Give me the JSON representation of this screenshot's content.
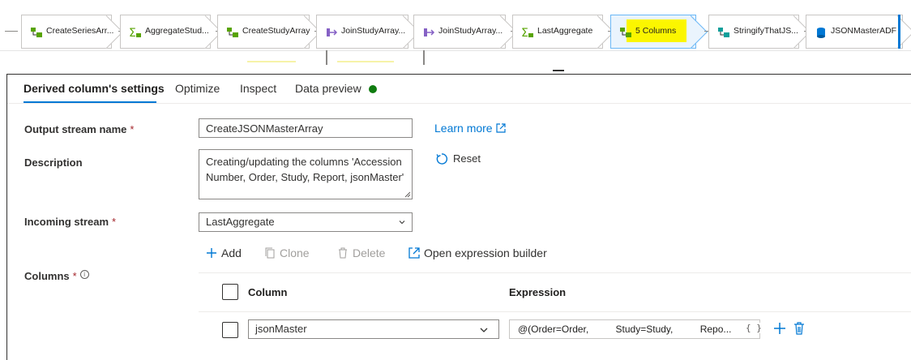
{
  "pipeline": {
    "nodes": [
      {
        "label": "CreateSeriesArr...",
        "icon": "derived-column-icon"
      },
      {
        "label": "AggregateStud...",
        "icon": "aggregate-icon"
      },
      {
        "label": "CreateStudyArray",
        "icon": "derived-column-icon"
      },
      {
        "label": "JoinStudyArray...",
        "icon": "join-icon"
      },
      {
        "label": "JoinStudyArray...",
        "icon": "join-icon"
      },
      {
        "label": "LastAggregate",
        "icon": "aggregate-icon"
      },
      {
        "label": "5 Columns",
        "icon": "derived-column-icon",
        "selected": true,
        "highlight": "#fbf600"
      },
      {
        "label": "StringifyThatJS...",
        "icon": "stringify-icon"
      },
      {
        "label": "JSONMasterADF",
        "icon": "sink-icon"
      }
    ]
  },
  "tabs": [
    {
      "label": "Derived column's settings",
      "active": true
    },
    {
      "label": "Optimize"
    },
    {
      "label": "Inspect"
    },
    {
      "label": "Data preview",
      "status_color": "#107c10"
    }
  ],
  "form": {
    "output_stream": {
      "label": "Output stream name",
      "required": "*",
      "value": "CreateJSONMasterArray"
    },
    "description": {
      "label": "Description",
      "value": "Creating/updating the columns 'Accession Number, Order, Study, Report, jsonMaster'"
    },
    "incoming": {
      "label": "Incoming stream",
      "required": "*",
      "value": "LastAggregate"
    },
    "columns": {
      "label": "Columns",
      "required": "*",
      "info": "i"
    }
  },
  "links": {
    "learn_more": "Learn more",
    "reset": "Reset"
  },
  "toolbar": {
    "add": "Add",
    "clone": "Clone",
    "delete": "Delete",
    "open_builder": "Open expression builder"
  },
  "grid": {
    "headers": {
      "column": "Column",
      "expression": "Expression"
    },
    "rows": [
      {
        "column": "jsonMaster",
        "expression": "@(Order=Order,          Study=Study,          Repo...",
        "brace": "{ }"
      }
    ]
  },
  "colors": {
    "accent": "#0078d4",
    "highlight": "#fbf600",
    "success": "#107c10",
    "required": "#a4262c"
  }
}
